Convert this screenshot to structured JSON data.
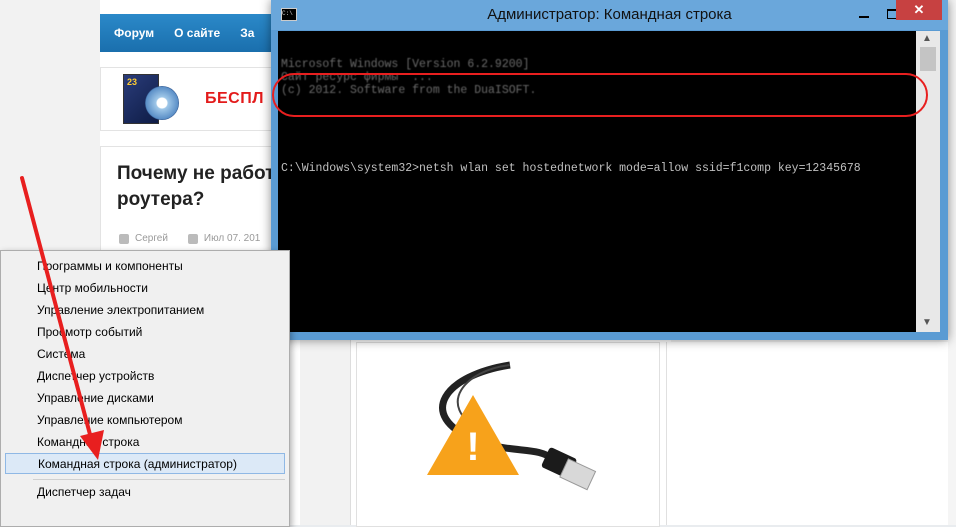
{
  "website": {
    "nav": [
      "Форум",
      "О сайте",
      "За"
    ],
    "banner_text": "БЕСПЛ",
    "dvd_label": "23",
    "article_title": "Почему не работ роутера?",
    "author": "Сергей",
    "date": "Июл 07. 201"
  },
  "cmd_window": {
    "title": "Администратор: Командная строка",
    "close_label": "✕",
    "blurred_lines": "Microsoft Windows [Version 6.2.9200]\nСайт ресурс фирмы  ...\n(c) 2012. Software from the DuaISOFT.",
    "command": "C:\\Windows\\system32>netsh wlan set hostednetwork mode=allow ssid=f1comp key=12345678"
  },
  "context_menu": {
    "items": [
      "Программы и компоненты",
      "Центр мобильности",
      "Управление электропитанием",
      "Просмотр событий",
      "Система",
      "Диспетчер устройств",
      "Управление дисками",
      "Управление компьютером",
      "Командная строка",
      "Командная строка (администратор)",
      "Диспетчер задач"
    ],
    "selected_index": 9
  },
  "colors": {
    "accent_red": "#e81f1f",
    "titlebar_blue": "#6aa7db",
    "nav_blue": "#1a6fad"
  }
}
